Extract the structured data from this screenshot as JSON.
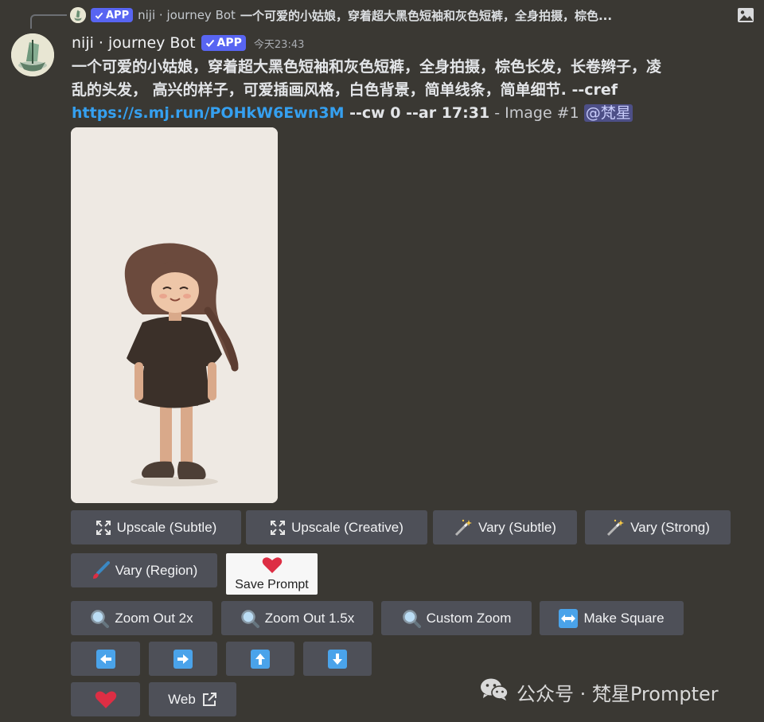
{
  "reply": {
    "tag": "APP",
    "name": "niji · journey Bot",
    "text": "一个可爱的小姑娘，穿着超大黑色短袖和灰色短裤，全身拍摄，棕色..."
  },
  "message": {
    "author": "niji · journey Bot",
    "tag": "APP",
    "timestamp": "今天23:43",
    "prompt_line1": "一个可爱的小姑娘，穿着超大黑色短袖和灰色短裤，全身拍摄，棕色长发，长卷辫子，凌",
    "prompt_line2": "乱的头发， 高兴的样子，可爱插画风格，白色背景，简单线条，简单细节. --cref",
    "link": "https://s.mj.run/POHkW6Ewn3M",
    "params": " --cw 0 --ar 17:31",
    "image_label": " - Image #1 ",
    "mention": "@梵星"
  },
  "buttons": {
    "upscale_subtle": "Upscale (Subtle)",
    "upscale_creative": "Upscale (Creative)",
    "vary_subtle": "Vary (Subtle)",
    "vary_strong": "Vary (Strong)",
    "vary_region": "Vary (Region)",
    "save_prompt": "Save Prompt",
    "zoom_out_2x": "Zoom Out 2x",
    "zoom_out_15x": "Zoom Out 1.5x",
    "custom_zoom": "Custom Zoom",
    "make_square": "Make Square",
    "web": "Web"
  },
  "icons": {
    "upscale": "expand-icon",
    "vary": "magic-wand-icon",
    "region": "paintbrush-icon",
    "zoom": "magnifier-icon",
    "square": "left-right-arrow-icon",
    "pan": [
      "left-arrow-icon",
      "right-arrow-icon",
      "up-arrow-icon",
      "down-arrow-icon"
    ],
    "favorite": "heart-icon",
    "external": "external-link-icon"
  },
  "colors": {
    "background": "#3a3833",
    "button": "#4e5058",
    "app_tag": "#5865f2",
    "link": "#35a0f0",
    "heart": "#dd2e44",
    "arrow": "#4aa3ea"
  },
  "watermark": {
    "text": "公众号 · 梵星Prompter"
  }
}
